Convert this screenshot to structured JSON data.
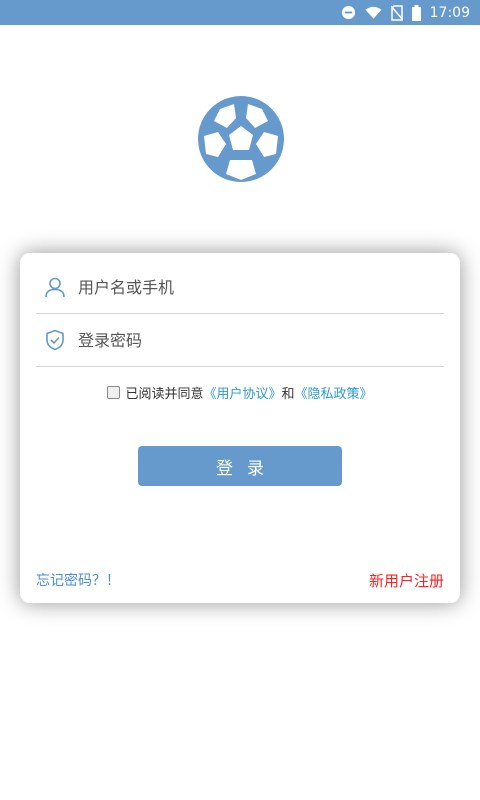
{
  "status_bar": {
    "time": "17:09",
    "icons": [
      "do-not-disturb-icon",
      "wifi-icon",
      "no-sim-icon",
      "battery-icon"
    ]
  },
  "logo": {
    "icon": "soccer-ball-icon",
    "color": "#6699cc"
  },
  "login_form": {
    "username_placeholder": "用户名或手机",
    "password_placeholder": "登录密码",
    "agreement": {
      "prefix": "已阅读并同意",
      "user_agreement": "《用户协议》",
      "conjunction": "和",
      "privacy_policy": "《隐私政策》"
    },
    "login_label": "登录",
    "forgot_password": "忘记密码？！",
    "register": "新用户注册"
  },
  "colors": {
    "primary": "#6699cc",
    "link": "#2a9bd3",
    "forgot": "#4a8fd0",
    "register": "#ff2020"
  }
}
